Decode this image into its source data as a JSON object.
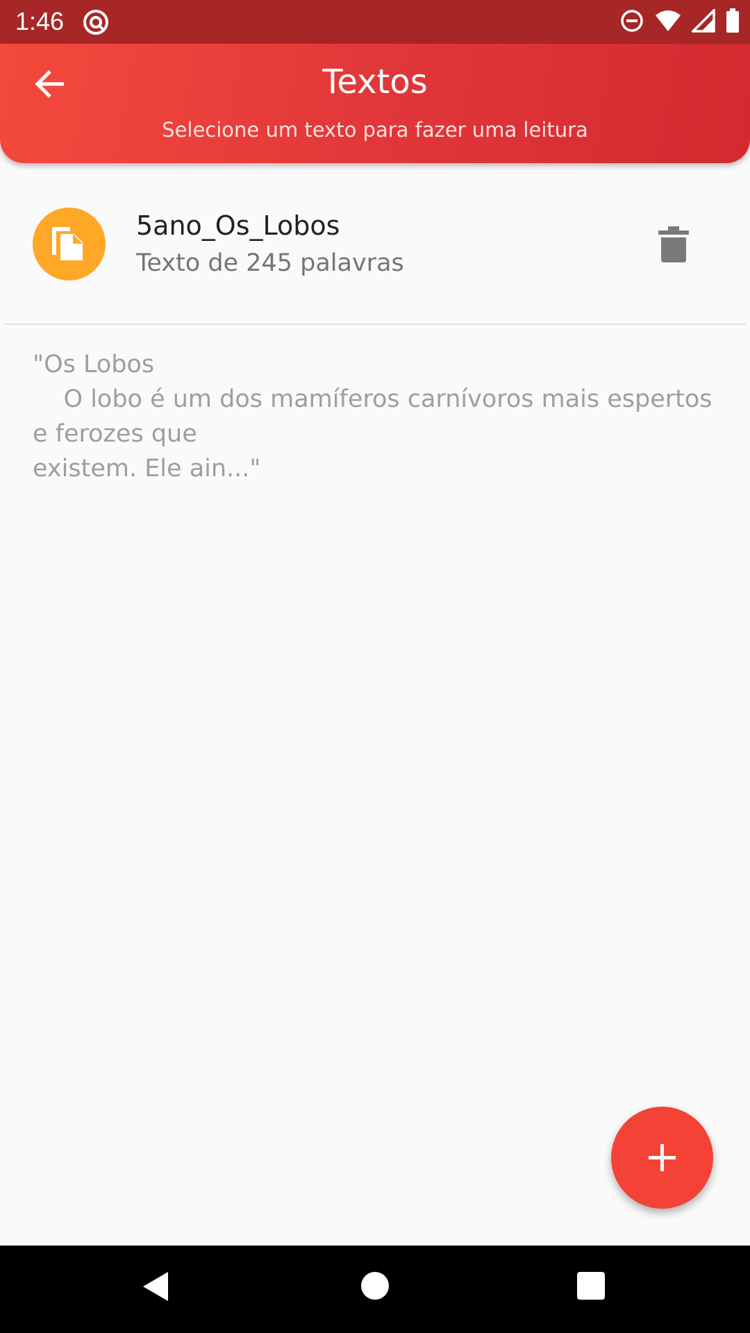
{
  "status_bar": {
    "time": "1:46",
    "icons": [
      "app-notification-icon",
      "do-not-disturb-icon",
      "wifi-icon",
      "signal-icon",
      "battery-icon"
    ]
  },
  "app_bar": {
    "back_icon": "arrow-back-icon",
    "title": "Textos",
    "subtitle": "Selecione um texto para fazer uma leitura",
    "gradient_start": "#f44a3c",
    "gradient_end": "#d32a2f"
  },
  "texts": [
    {
      "icon": "document-copy-icon",
      "icon_bg": "#ffa726",
      "title": "5ano_Os_Lobos",
      "subtitle": "Texto de 245 palavras",
      "delete_icon": "trash-icon",
      "preview": "\"Os Lobos\n    O lobo é um dos mamíferos carnívoros mais espertos e ferozes que\nexistem. Ele ain...\""
    }
  ],
  "fab": {
    "icon": "plus-icon",
    "color": "#f44336"
  },
  "nav_bar": {
    "icons": [
      "nav-back-icon",
      "nav-home-icon",
      "nav-recents-icon"
    ]
  }
}
